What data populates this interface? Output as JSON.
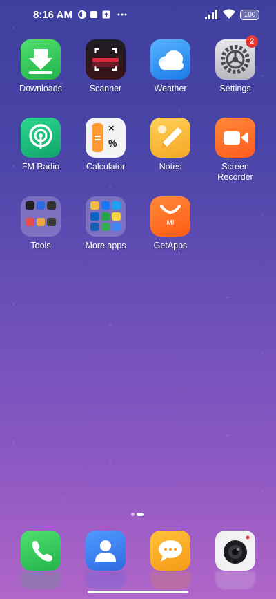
{
  "status_bar": {
    "time": "8:16 AM",
    "battery": "100"
  },
  "apps": [
    {
      "label": "Downloads"
    },
    {
      "label": "Scanner"
    },
    {
      "label": "Weather"
    },
    {
      "label": "Settings",
      "badge": "2"
    },
    {
      "label": "FM Radio"
    },
    {
      "label": "Calculator"
    },
    {
      "label": "Notes"
    },
    {
      "label": "Screen Recorder"
    },
    {
      "label": "Tools"
    },
    {
      "label": "More apps"
    },
    {
      "label": "GetApps"
    }
  ],
  "calculator_symbols": {
    "times": "×",
    "percent": "%"
  },
  "getapps_text": "MI",
  "dock": [
    "phone-icon",
    "contacts-icon",
    "messages-icon",
    "camera-icon"
  ],
  "colors": {
    "downloads": "#2fc45a",
    "weather": "#2f8bf0",
    "fm_radio": "#1fb27a",
    "notes": "#f6b53a",
    "recorder": "#ff6a2a",
    "getapps": "#ff6a1e",
    "badge": "#e53935"
  }
}
